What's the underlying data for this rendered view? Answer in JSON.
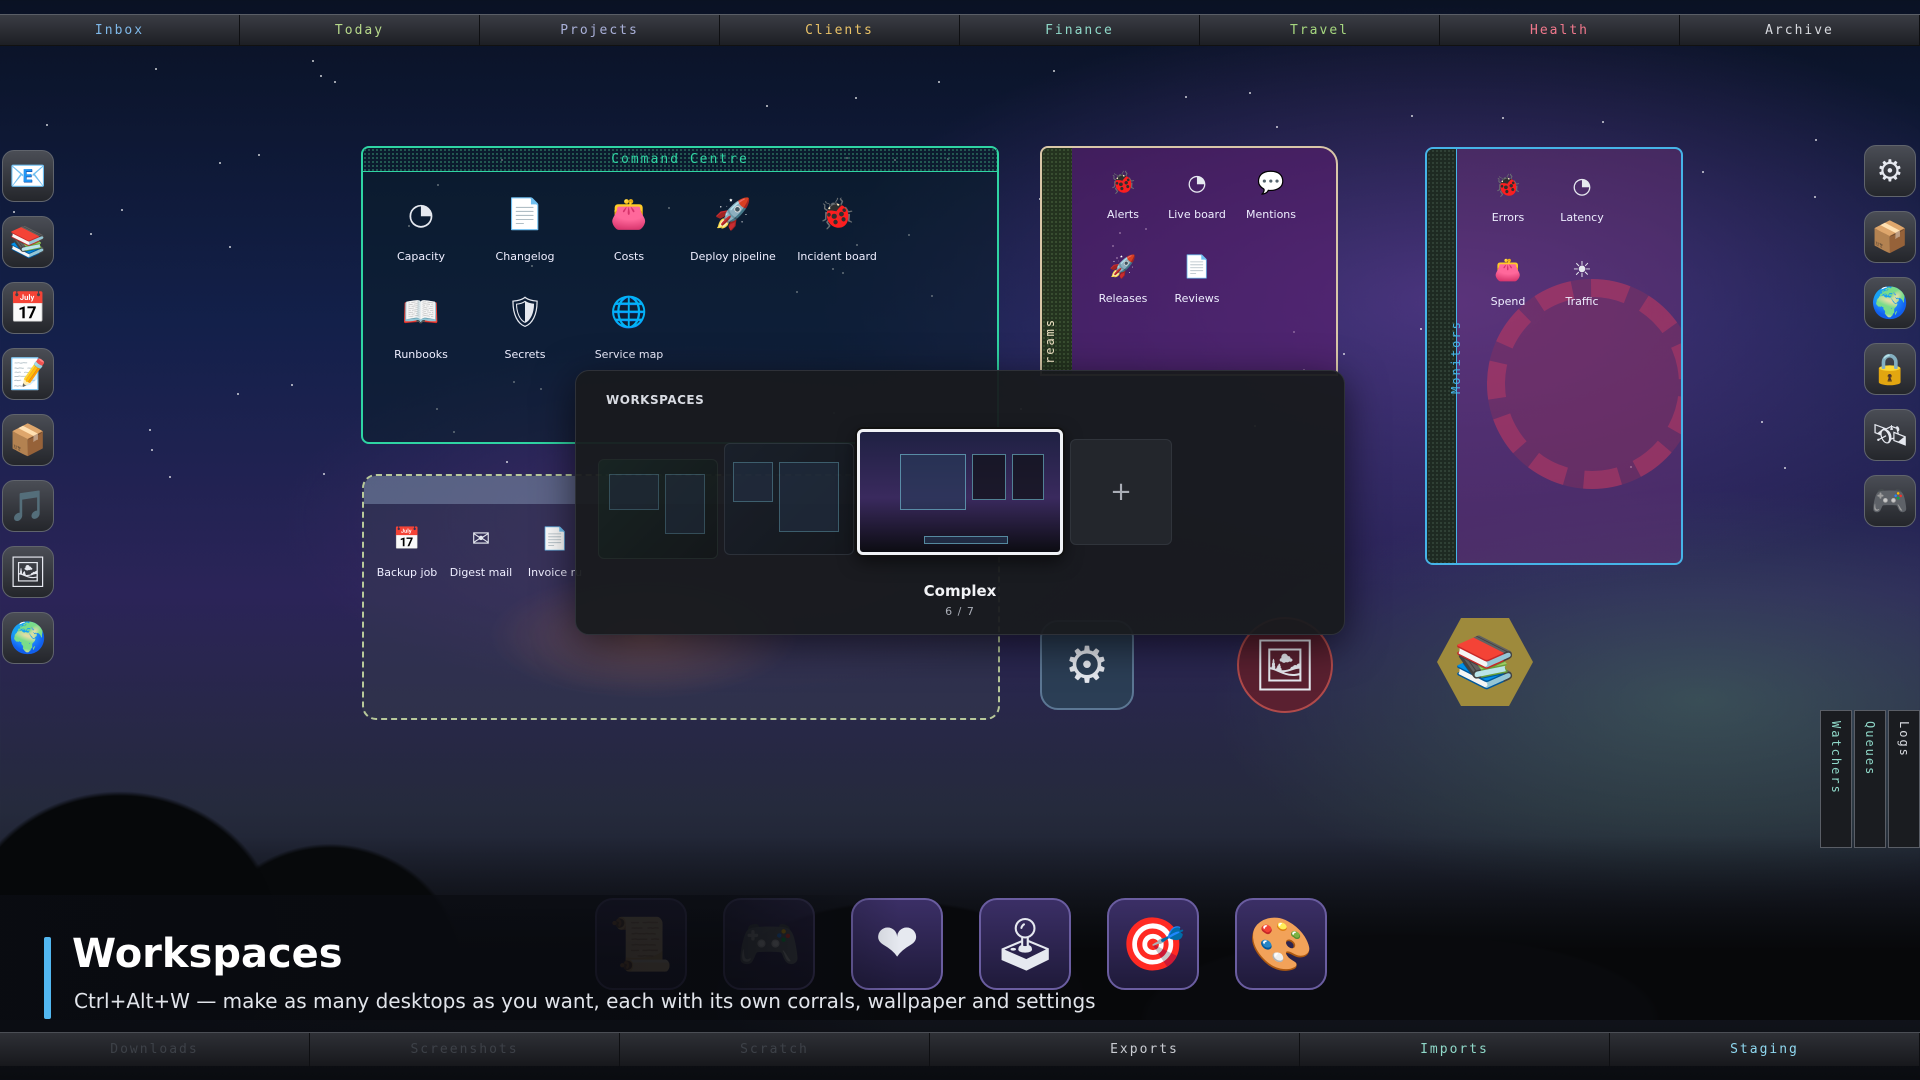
{
  "top_tabs": [
    {
      "label": "Inbox",
      "color": "#7fb8e8"
    },
    {
      "label": "Today",
      "color": "#b6d88a"
    },
    {
      "label": "Projects",
      "color": "#a9b0d8"
    },
    {
      "label": "Clients",
      "color": "#e9c267"
    },
    {
      "label": "Finance",
      "color": "#8fd8c8"
    },
    {
      "label": "Travel",
      "color": "#a6d77f"
    },
    {
      "label": "Health",
      "color": "#f0788c"
    },
    {
      "label": "Archive",
      "color": "#d7d9de"
    }
  ],
  "left_dock": [
    {
      "name": "mail-icon",
      "glyph": "📧"
    },
    {
      "name": "books-icon",
      "glyph": "📚"
    },
    {
      "name": "calendar-icon",
      "glyph": "📅"
    },
    {
      "name": "notepad-icon",
      "glyph": "📝"
    },
    {
      "name": "package-icon",
      "glyph": "📦"
    },
    {
      "name": "music-icon",
      "glyph": "🎵"
    },
    {
      "name": "picture-icon",
      "glyph": "🖼"
    },
    {
      "name": "globe-icon",
      "glyph": "🌍"
    }
  ],
  "right_dock": [
    {
      "name": "gear-icon",
      "glyph": "⚙"
    },
    {
      "name": "package-icon",
      "glyph": "📦"
    },
    {
      "name": "globe-icon",
      "glyph": "🌍"
    },
    {
      "name": "lock-icon",
      "glyph": "🔒"
    },
    {
      "name": "satellite-icon",
      "glyph": "🛰"
    },
    {
      "name": "gamepad-icon",
      "glyph": "🎮"
    }
  ],
  "command_centre": {
    "title": "Command Centre",
    "items": [
      {
        "label": "Capacity",
        "icon": "gauge-icon",
        "glyph": "◔"
      },
      {
        "label": "Changelog",
        "icon": "document-icon",
        "glyph": "📄"
      },
      {
        "label": "Costs",
        "icon": "wallet-icon",
        "glyph": "👛"
      },
      {
        "label": "Deploy pipeline",
        "icon": "rocket-icon",
        "glyph": "🚀"
      },
      {
        "label": "Incident board",
        "icon": "bug-icon",
        "glyph": "🐞"
      },
      {
        "label": "Runbooks",
        "icon": "book-icon",
        "glyph": "📖"
      },
      {
        "label": "Secrets",
        "icon": "shield-icon",
        "glyph": "🛡"
      },
      {
        "label": "Service map",
        "icon": "globe-icon",
        "glyph": "🌐"
      }
    ]
  },
  "streams": {
    "spine_label": "reams",
    "items": [
      {
        "label": "Alerts",
        "icon": "bug-icon",
        "glyph": "🐞"
      },
      {
        "label": "Live board",
        "icon": "gauge-icon",
        "glyph": "◔"
      },
      {
        "label": "Mentions",
        "icon": "chat-icon",
        "glyph": "💬"
      },
      {
        "label": "Releases",
        "icon": "rocket-icon",
        "glyph": "🚀"
      },
      {
        "label": "Reviews",
        "icon": "document-icon",
        "glyph": "📄"
      }
    ]
  },
  "monitors": {
    "spine_label": "Monitors",
    "items": [
      {
        "label": "Errors",
        "icon": "bug-icon",
        "glyph": "🐞"
      },
      {
        "label": "Latency",
        "icon": "gauge-icon",
        "glyph": "◔"
      },
      {
        "label": "Spend",
        "icon": "wallet-icon",
        "glyph": "👛"
      },
      {
        "label": "Traffic",
        "icon": "sun-icon",
        "glyph": "☀"
      }
    ]
  },
  "scheduler": {
    "items": [
      {
        "label": "Backup job",
        "icon": "calendar-icon",
        "glyph": "📅"
      },
      {
        "label": "Digest mail",
        "icon": "envelope-icon",
        "glyph": "✉"
      },
      {
        "label": "Invoice ru",
        "icon": "document-icon",
        "glyph": "📄"
      }
    ]
  },
  "floating_icons": [
    {
      "name": "gear-icon",
      "glyph": "⚙"
    },
    {
      "name": "picture-icon",
      "glyph": "🖼"
    },
    {
      "name": "books-icon",
      "glyph": "📚"
    }
  ],
  "right_vertical_tabs": [
    {
      "label": "Watchers",
      "color": "#8fd8c8"
    },
    {
      "label": "Queues",
      "color": "#8fd8c8"
    },
    {
      "label": "Logs",
      "color": "#d7d9de"
    }
  ],
  "workspaces": {
    "title": "WORKSPACES",
    "current_name": "Complex",
    "current_position": "6 / 7",
    "add_glyph": "+"
  },
  "bottom_dock": [
    {
      "name": "scroll-icon",
      "glyph": "📜",
      "faded": true
    },
    {
      "name": "gamepad-icon",
      "glyph": "🎮",
      "faded": true
    },
    {
      "name": "heart-icon",
      "glyph": "❤",
      "faded": false
    },
    {
      "name": "joystick-icon",
      "glyph": "🕹",
      "faded": false
    },
    {
      "name": "target-icon",
      "glyph": "🎯",
      "faded": false
    },
    {
      "name": "palette-icon",
      "glyph": "🎨",
      "faded": false
    }
  ],
  "caption": {
    "heading": "Workspaces",
    "subtitle": "Ctrl+Alt+W — make as many desktops as you want, each with its own corrals, wallpaper and settings"
  },
  "bottom_tabs": [
    {
      "label": "Downloads",
      "dim": true,
      "color": "#3d4148"
    },
    {
      "label": "Screenshots",
      "dim": true,
      "color": "#3d4148"
    },
    {
      "label": "Scratch",
      "dim": true,
      "color": "#3d4148"
    },
    {
      "label": "Exports",
      "dim": false,
      "color": "#c9ccd2"
    },
    {
      "label": "Imports",
      "dim": false,
      "color": "#8fd8c8"
    },
    {
      "label": "Staging",
      "dim": false,
      "color": "#8fd8f0"
    }
  ],
  "colors": {
    "accent_caption_bar": "#52b7f0",
    "command_centre_border": "#2fd4a3",
    "monitors_border": "#46b4e8"
  }
}
